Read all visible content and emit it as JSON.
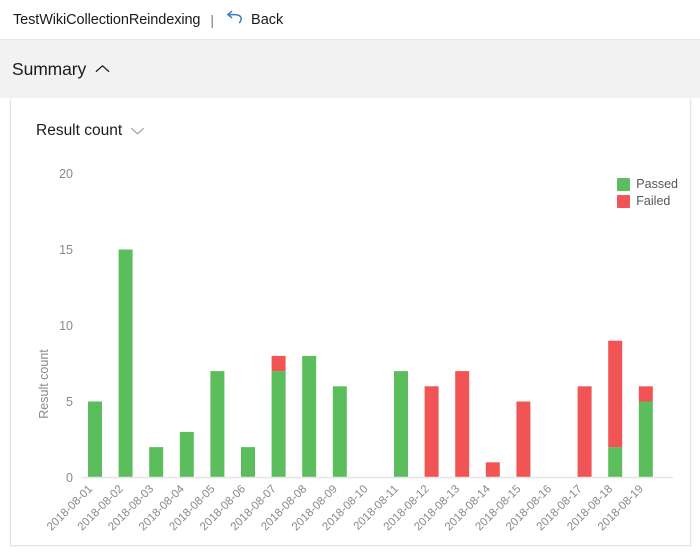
{
  "header": {
    "run_title": "TestWikiCollectionReindexing",
    "separator": "|",
    "back_label": "Back",
    "back_icon": "undo-arrow-icon"
  },
  "summary_section": {
    "title": "Summary",
    "collapse_icon": "chevron-up-icon",
    "expanded": true
  },
  "metric_selector": {
    "label": "Result count",
    "icon": "chevron-down-icon"
  },
  "legend": [
    {
      "label": "Passed",
      "color": "#5cbd5c"
    },
    {
      "label": "Failed",
      "color": "#f05454"
    }
  ],
  "colors": {
    "passed": "#5cbd5c",
    "failed": "#f05454",
    "band": "#f2f2f2",
    "axis_text": "#8a8a8e",
    "card_border": "#e4e4e4",
    "accent_blue": "#3a78c3"
  },
  "chart_data": {
    "type": "bar",
    "title": "",
    "subtitle": "",
    "xlabel": "",
    "ylabel": "Result count",
    "ylim": [
      0,
      20
    ],
    "yticks": [
      0,
      5,
      10,
      15,
      20
    ],
    "grid": false,
    "stacked": true,
    "legend_position": "top-right",
    "categories": [
      "2018-08-01",
      "2018-08-02",
      "2018-08-03",
      "2018-08-04",
      "2018-08-05",
      "2018-08-06",
      "2018-08-07",
      "2018-08-08",
      "2018-08-09",
      "2018-08-10",
      "2018-08-11",
      "2018-08-12",
      "2018-08-13",
      "2018-08-14",
      "2018-08-15",
      "2018-08-16",
      "2018-08-17",
      "2018-08-18",
      "2018-08-19"
    ],
    "series": [
      {
        "name": "Passed",
        "color": "#5cbd5c",
        "values": [
          5,
          15,
          2,
          3,
          7,
          2,
          7,
          8,
          6,
          0,
          7,
          0,
          0,
          0,
          0,
          0,
          0,
          2,
          5
        ]
      },
      {
        "name": "Failed",
        "color": "#f05454",
        "values": [
          0,
          0,
          0,
          0,
          0,
          0,
          1,
          0,
          0,
          0,
          0,
          6,
          7,
          1,
          5,
          0,
          6,
          7,
          1
        ]
      }
    ],
    "totals": [
      5,
      15,
      2,
      3,
      7,
      2,
      8,
      8,
      6,
      0,
      7,
      6,
      7,
      1,
      5,
      0,
      6,
      9,
      6
    ]
  }
}
